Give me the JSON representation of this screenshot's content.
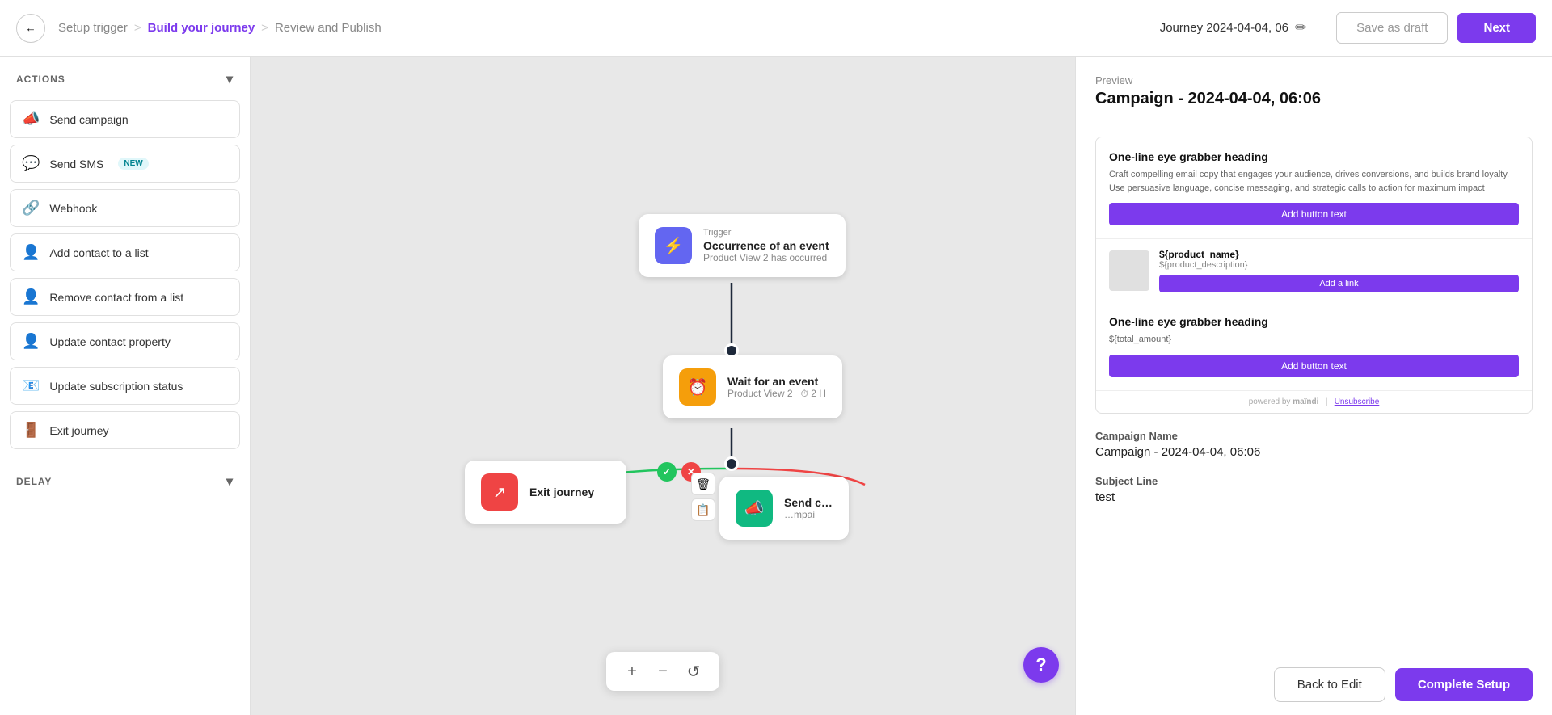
{
  "topNav": {
    "backArrow": "←",
    "breadcrumb": [
      {
        "label": "Setup trigger",
        "active": false
      },
      {
        "label": "Build your journey",
        "active": true
      },
      {
        "label": "Review and Publish",
        "active": false
      }
    ],
    "journeyTitle": "Journey 2024-04-04, 06",
    "editIcon": "✏",
    "saveDraftLabel": "Save as draft",
    "nextLabel": "Next"
  },
  "sidebar": {
    "actionsHeader": "ACTIONS",
    "actions": [
      {
        "icon": "📣",
        "label": "Send campaign"
      },
      {
        "icon": "💬",
        "label": "Send SMS",
        "badge": "NEW"
      },
      {
        "icon": "🔗",
        "label": "Webhook"
      },
      {
        "icon": "👤+",
        "label": "Add contact to a list"
      },
      {
        "icon": "👤-",
        "label": "Remove contact from a list"
      },
      {
        "icon": "👤↑",
        "label": "Update contact property"
      },
      {
        "icon": "📧",
        "label": "Update subscription status"
      },
      {
        "icon": "🚪",
        "label": "Exit journey"
      }
    ],
    "delayHeader": "DELAY"
  },
  "canvas": {
    "triggerNode": {
      "label": "Trigger",
      "title": "Occurrence of an event",
      "subtitle": "Product View 2 has occurred"
    },
    "waitNode": {
      "title": "Wait for an event",
      "subtitle1": "Product View 2",
      "subtitle2": "2 H"
    },
    "exitNode": {
      "title": "Exit journey"
    },
    "sendNode": {
      "title": "Send c…",
      "subtitle": "…mpai"
    },
    "toolbarPlus": "+",
    "toolbarMinus": "−",
    "toolbarRefresh": "↺",
    "helpLabel": "?"
  },
  "previewPanel": {
    "previewLabel": "Preview",
    "previewTitle": "Campaign - 2024-04-04, 06:06",
    "emailHeading1": "One-line eye grabber heading",
    "emailBody1": "Craft compelling email copy that engages your audience, drives conversions, and builds brand loyalty. Use persuasive language, concise messaging, and strategic calls to action for maximum impact",
    "emailBtnText": "Add button text",
    "productName": "${product_name}",
    "productDesc": "${product_description}",
    "productLinkBtn": "Add a link",
    "emailHeading2": "One-line eye grabber heading",
    "emailTotal": "${total_amount}",
    "emailBtn2Text": "Add button text",
    "footerPowered": "powered by",
    "footerBrand": "maïndi",
    "footerUnsubscribe": "Unsubscribe",
    "campaignNameLabel": "Campaign Name",
    "campaignNameValue": "Campaign - 2024-04-04, 06:06",
    "subjectLineLabel": "Subject Line",
    "subjectLineValue": "test"
  },
  "bottomBar": {
    "backToEditLabel": "Back to Edit",
    "completeSetupLabel": "Complete Setup"
  }
}
